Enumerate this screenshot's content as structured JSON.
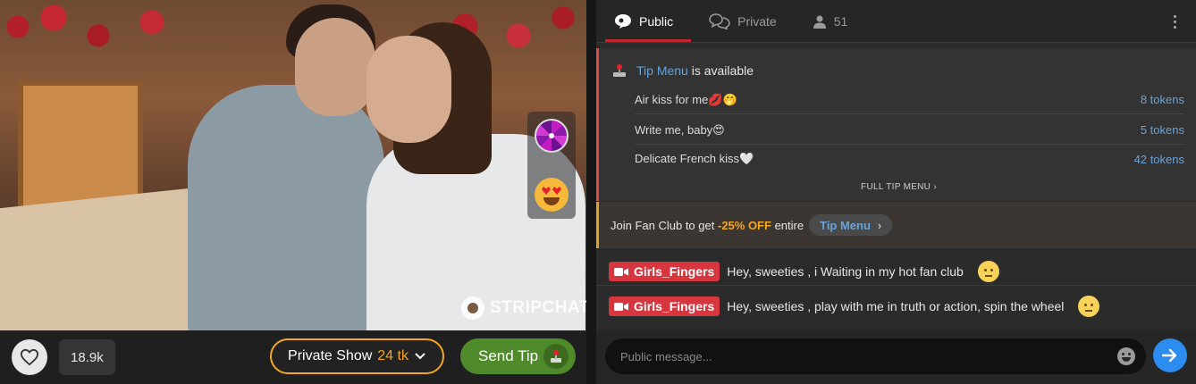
{
  "player": {
    "watermark": "STRIPCHAT",
    "like_count": "18.9k",
    "private_show": {
      "label": "Private Show",
      "price": "24 tk"
    },
    "send_tip_label": "Send Tip"
  },
  "chat": {
    "tabs": [
      {
        "label": "Public",
        "icon": "chat-bubble-icon",
        "active": true
      },
      {
        "label": "Private",
        "icon": "chat-bubbles-icon",
        "active": false
      },
      {
        "label": "51",
        "icon": "user-icon",
        "active": false
      }
    ],
    "tip_menu": {
      "link": "Tip Menu",
      "suffix": " is available",
      "items": [
        {
          "name": "Air kiss for me💋🤭",
          "price": "8 tokens"
        },
        {
          "name": "Write me, baby😍",
          "price": "5 tokens"
        },
        {
          "name": "Delicate French kiss🤍",
          "price": "42 tokens"
        }
      ],
      "full_label": "FULL TIP MENU"
    },
    "fan_club": {
      "prefix": "Join Fan Club to get",
      "discount": "-25% OFF",
      "middle": "entire",
      "pill": "Tip Menu"
    },
    "messages": [
      {
        "user": "Girls_Fingers",
        "text": "Hey, sweeties , i Waiting in my hot fan club"
      },
      {
        "user": "Girls_Fingers",
        "text": "Hey, sweeties , play with me in truth or action, spin the wheel"
      }
    ],
    "input_placeholder": "Public message..."
  },
  "colors": {
    "accent_red": "#c0272d",
    "tip_green": "#4f8a2b",
    "private_orange": "#f5a623",
    "link_blue": "#5fa3e0",
    "send_blue": "#2d8cf0"
  }
}
